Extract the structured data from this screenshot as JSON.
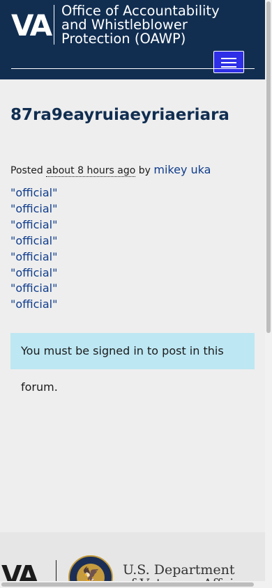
{
  "header": {
    "logo_text": "VA",
    "office_title_lines": [
      "Office of Accountability",
      "and Whistleblower",
      "Protection (OAWP)"
    ],
    "menu_icon": "hamburger-menu-icon"
  },
  "post": {
    "title": "87ra9eayruiaeyriaeriara",
    "posted_label": "Posted",
    "time_ago": "about 8 hours ago",
    "by_label": "by",
    "author": "mikey uka",
    "lines": [
      "\"official\"",
      "\"official\"",
      "\"official\"",
      "\"official\"",
      "\"official\"",
      "\"official\"",
      "\"official\"",
      "\"official\""
    ]
  },
  "notice": {
    "text": "You must be signed in to post in this forum."
  },
  "footer": {
    "logo_text": "VA",
    "department_lines": [
      "U.S. Department",
      "of Veterans Affairs"
    ],
    "seal_icon": "va-seal-icon"
  },
  "colors": {
    "header_bg": "#112e51",
    "menu_button": "#2e2fe6",
    "link": "#0f3c8c",
    "notice_bg": "#bde7f3"
  }
}
